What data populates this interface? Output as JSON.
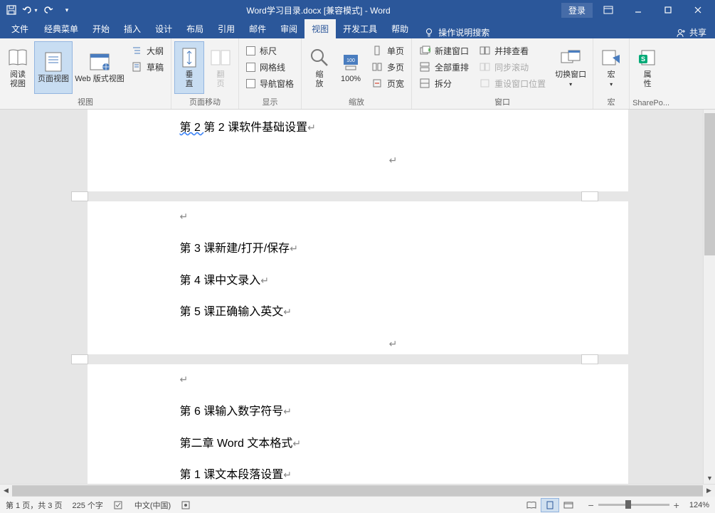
{
  "titlebar": {
    "doc_title": "Word学习目录.docx [兼容模式] - Word",
    "login": "登录"
  },
  "tabs": {
    "file": "文件",
    "classic": "经典菜单",
    "home": "开始",
    "insert": "插入",
    "design": "设计",
    "layout": "布局",
    "references": "引用",
    "mail": "邮件",
    "review": "审阅",
    "view": "视图",
    "developer": "开发工具",
    "help": "帮助",
    "tellme": "操作说明搜索",
    "share": "共享"
  },
  "ribbon": {
    "views": {
      "label": "视图",
      "read": "阅读\n视图",
      "print": "页面视图",
      "web": "Web 版式视图",
      "outline": "大纲",
      "draft": "草稿"
    },
    "pagemove": {
      "label": "页面移动",
      "vertical": "垂\n直",
      "sidebyside": "翻\n页"
    },
    "show": {
      "label": "显示",
      "ruler": "标尺",
      "gridlines": "网格线",
      "navpane": "导航窗格"
    },
    "zoom": {
      "label": "缩放",
      "zoom": "缩\n放",
      "hundred": "100%",
      "onepage": "单页",
      "multipage": "多页",
      "pagewidth": "页宽"
    },
    "window": {
      "label": "窗口",
      "newwin": "新建窗口",
      "arrange": "全部重排",
      "split": "拆分",
      "viewside": "并排查看",
      "syncscroll": "同步滚动",
      "resetpos": "重设窗口位置",
      "switch": "切换窗口"
    },
    "macros": {
      "label": "宏",
      "macro": "宏"
    },
    "sharepoint": {
      "label": "SharePo...",
      "properties": "属\n性"
    }
  },
  "document": {
    "lines": [
      "第 2 课软件基础设置",
      "第 3 课新建/打开/保存",
      "第 4 课中文录入",
      "第 5 课正确输入英文",
      "第 6 课输入数字符号",
      "第二章 Word 文本格式",
      "第 1 课文本段落设置"
    ]
  },
  "statusbar": {
    "page": "第 1 页，共 3 页",
    "words": "225 个字",
    "lang": "中文(中国)",
    "zoom": "124%"
  }
}
